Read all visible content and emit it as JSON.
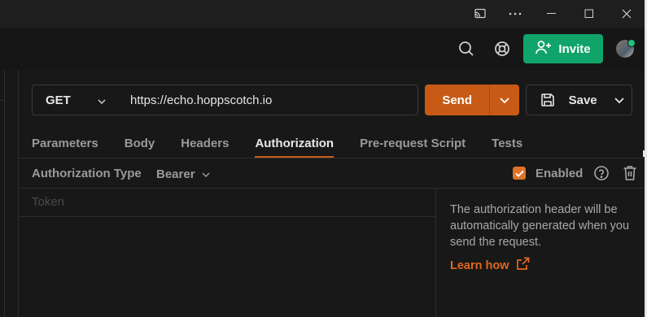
{
  "titlebar": {
    "controls": [
      "cast-icon",
      "more-icon",
      "minimize-icon",
      "maximize-icon",
      "close-icon"
    ]
  },
  "header": {
    "invite_label": "Invite"
  },
  "request": {
    "method": "GET",
    "url": "https://echo.hoppscotch.io",
    "send_label": "Send",
    "save_label": "Save"
  },
  "tabs": [
    {
      "label": "Parameters"
    },
    {
      "label": "Body"
    },
    {
      "label": "Headers"
    },
    {
      "label": "Authorization",
      "active": true
    },
    {
      "label": "Pre-request Script"
    },
    {
      "label": "Tests"
    }
  ],
  "auth": {
    "type_label": "Authorization Type",
    "type_value": "Bearer",
    "enabled_label": "Enabled",
    "enabled": true,
    "token_placeholder": "Token",
    "info": "The authorization header will be automatically generated when you send the request.",
    "learn_label": "Learn how"
  },
  "colors": {
    "accent": "#c75b16",
    "invite": "#10a36a",
    "link": "#e2671c"
  }
}
